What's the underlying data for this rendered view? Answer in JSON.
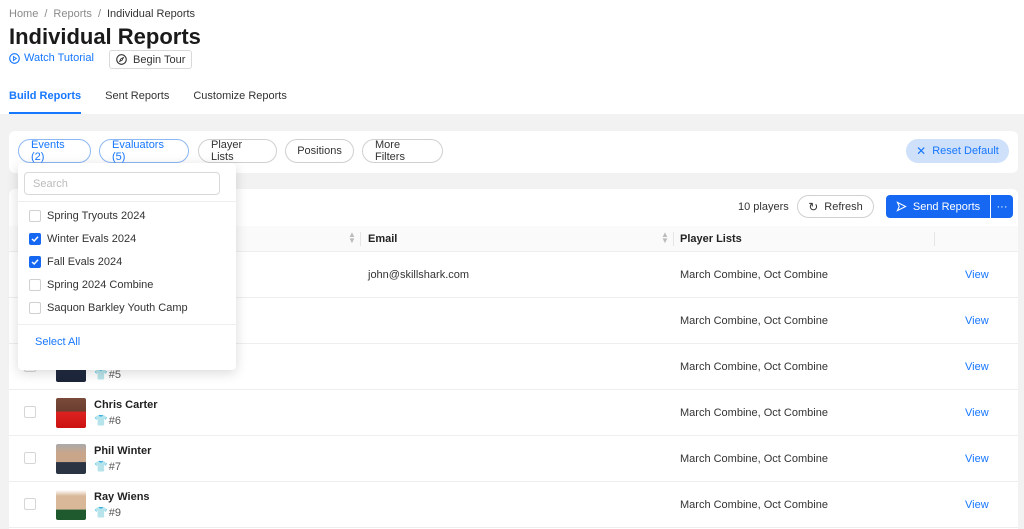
{
  "breadcrumb": [
    "Home",
    "Reports",
    "Individual Reports"
  ],
  "page_title": "Individual Reports",
  "watch_tutorial": "Watch Tutorial",
  "begin_tour": "Begin Tour",
  "tabs": [
    {
      "label": "Build Reports",
      "active": true
    },
    {
      "label": "Sent Reports",
      "active": false
    },
    {
      "label": "Customize Reports",
      "active": false
    }
  ],
  "filters": [
    {
      "label": "Events (2)",
      "selected": true
    },
    {
      "label": "Evaluators (5)",
      "selected": true
    },
    {
      "label": "Player Lists",
      "selected": false
    },
    {
      "label": "Positions",
      "selected": false
    },
    {
      "label": "More Filters",
      "selected": false
    }
  ],
  "reset_default": "Reset Default",
  "player_count": "10 players",
  "refresh": "Refresh",
  "send_reports": "Send Reports",
  "more_actions": "···",
  "columns": {
    "email": "Email",
    "player_lists": "Player Lists"
  },
  "rows": [
    {
      "name": "",
      "number": "",
      "email": "john@skillshark.com",
      "lists": "March Combine, Oct Combine",
      "action": "View"
    },
    {
      "name": "",
      "number": "",
      "email": "",
      "lists": "March Combine, Oct Combine",
      "action": "View"
    },
    {
      "name": "",
      "number": "#5",
      "email": "",
      "lists": "March Combine, Oct Combine",
      "action": "View"
    },
    {
      "name": "Chris Carter",
      "number": "#6",
      "email": "",
      "lists": "March Combine, Oct Combine",
      "action": "View"
    },
    {
      "name": "Phil Winter",
      "number": "#7",
      "email": "",
      "lists": "March Combine, Oct Combine",
      "action": "View"
    },
    {
      "name": "Ray Wiens",
      "number": "#9",
      "email": "",
      "lists": "March Combine, Oct Combine",
      "action": "View"
    }
  ],
  "dropdown": {
    "search_placeholder": "Search",
    "options": [
      {
        "label": "Spring Tryouts 2024",
        "checked": false
      },
      {
        "label": "Winter Evals 2024",
        "checked": true
      },
      {
        "label": "Fall Evals 2024",
        "checked": true
      },
      {
        "label": "Spring 2024 Combine",
        "checked": false
      },
      {
        "label": "Saquon Barkley Youth Camp",
        "checked": false
      }
    ],
    "select_all": "Select All"
  },
  "colors": {
    "accent": "#1668f2",
    "link": "#1677ff",
    "reset_bg": "#cfe0fb"
  }
}
